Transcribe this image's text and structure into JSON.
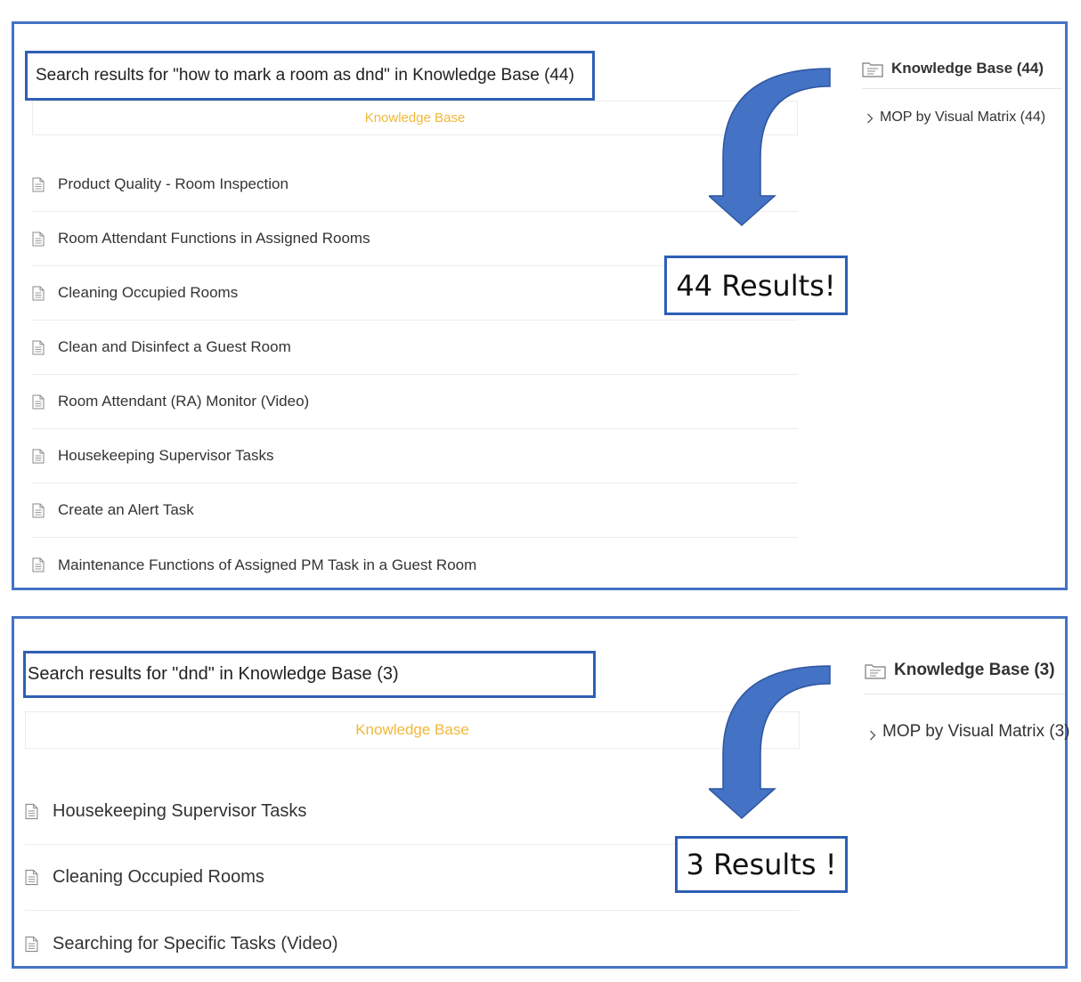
{
  "top_panel": {
    "search_heading": "Search results for \"how to mark a room as dnd\" in Knowledge Base (44)",
    "tab_label": "Knowledge Base",
    "results": [
      "Product Quality - Room Inspection",
      "Room Attendant Functions in Assigned Rooms",
      "Cleaning Occupied Rooms",
      "Clean and Disinfect a Guest Room",
      "Room Attendant (RA) Monitor (Video)",
      "Housekeeping Supervisor Tasks",
      "Create an Alert Task",
      "Maintenance Functions of Assigned PM Task in a Guest Room"
    ],
    "sidebar": {
      "title": "Knowledge Base (44)",
      "category": "MOP by Visual Matrix (44)"
    },
    "callout": "44 Results!"
  },
  "bottom_panel": {
    "search_heading": "Search results for \"dnd\" in Knowledge Base (3)",
    "tab_label": "Knowledge Base",
    "results": [
      "Housekeeping Supervisor Tasks",
      "Cleaning Occupied Rooms",
      "Searching for Specific Tasks (Video)"
    ],
    "sidebar": {
      "title": "Knowledge Base (3)",
      "category": "MOP by Visual Matrix (3)"
    },
    "callout": "3 Results !"
  },
  "colors": {
    "frame_border": "#4472c4",
    "highlight_border": "#2e5fb5",
    "arrow_fill": "#4472c4",
    "tab_text": "#f0b83a"
  },
  "icons": {
    "result": "document-icon",
    "sidebar_title": "folder-icon",
    "sidebar_item": "chevron-right-icon",
    "annotation": "curved-arrow-down"
  }
}
